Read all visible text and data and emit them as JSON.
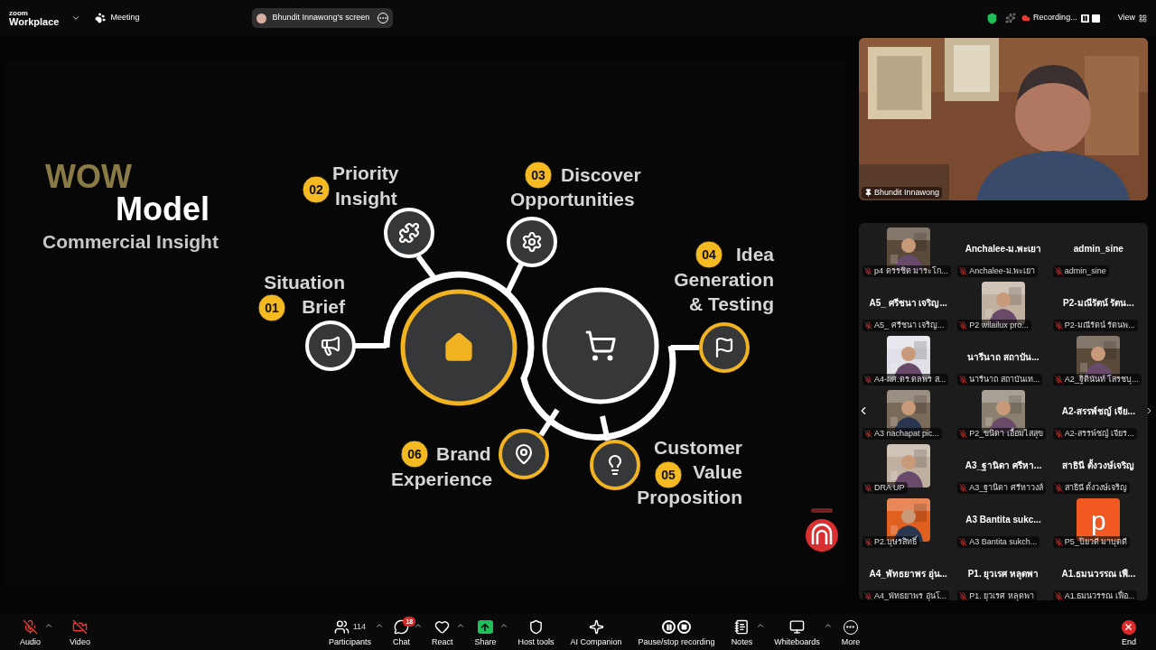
{
  "top_bar": {
    "logo_top": "zoom",
    "logo_bottom": "Workplace",
    "meeting": "Meeting",
    "share_pill": "Bhundit Innawong's screen",
    "recording": "Recording...",
    "view": "View"
  },
  "slide": {
    "title_top": "WOW",
    "title_main": "Model",
    "subtitle": "Commercial Insight",
    "steps": [
      {
        "num": "01",
        "lines": [
          "Situation",
          "Brief"
        ],
        "accent": false
      },
      {
        "num": "02",
        "lines": [
          "Priority",
          "Insight"
        ],
        "accent": false
      },
      {
        "num": "03",
        "lines": [
          "Discover",
          "Opportunities"
        ],
        "accent": false
      },
      {
        "num": "04",
        "lines": [
          "Idea",
          "Generation",
          "& Testing"
        ],
        "accent": true
      },
      {
        "num": "06",
        "lines": [
          "Brand",
          "Experience"
        ],
        "accent": true
      },
      {
        "num": "05",
        "lines": [
          "Customer",
          "Value",
          "Proposition"
        ],
        "accent": true
      }
    ]
  },
  "speaker": {
    "name": "Bhundit Innawong"
  },
  "gallery": [
    {
      "kind": "video",
      "label": "p4 ดรรชิต มาระโก..."
    },
    {
      "kind": "name",
      "display": "Anchalee-ม.พะเยา",
      "label": "Anchalee-ม.พะเยา"
    },
    {
      "kind": "name",
      "display": "admin_sine",
      "label": "admin_sine"
    },
    {
      "kind": "name",
      "display": "A5_ ศรีชนา เจริญ...",
      "label": "A5_ ศรีชนา เจริญ..."
    },
    {
      "kind": "video",
      "label": "P2 wilailux pro..."
    },
    {
      "kind": "name",
      "display": "P2-มณีรัตน์ รัตน...",
      "label": "P2-มณีรัตน์ รัตนพ..."
    },
    {
      "kind": "video",
      "label": "A4-ผศ.ดร.ดลพร ส..."
    },
    {
      "kind": "name",
      "display": "นารีนาถ สถาบัน...",
      "label": "นารีนาถ สถาบันเท..."
    },
    {
      "kind": "video",
      "label": "A2_ฐิตินันท์ โสรชบุ..."
    },
    {
      "kind": "video",
      "label": "A3 nachapat pic..."
    },
    {
      "kind": "video",
      "label": "P2_ขนิดา เอื้อมไสสุข"
    },
    {
      "kind": "name",
      "display": "A2-สรรพ์ชญ์ เจีย...",
      "label": "A2-สรรพ์ชญ์ เจียร..."
    },
    {
      "kind": "video",
      "label": "DRA UP"
    },
    {
      "kind": "name",
      "display": "A3_ฐานิดา ศรีหา...",
      "label": "A3_ฐานิดา ศรีหาวงส์"
    },
    {
      "kind": "name",
      "display": "สาธินี ตั้งวงษ์เจริญ",
      "label": "สาธินี ตั้งวงษ์เจริญ"
    },
    {
      "kind": "video",
      "label": "P2.บุษรสิทธิ์"
    },
    {
      "kind": "name",
      "display": "A3 Bantita sukc...",
      "label": "A3 Bantita sukch..."
    },
    {
      "kind": "letter",
      "display": "p",
      "label": "P5_ปิยวดี มาบุตดี"
    },
    {
      "kind": "name",
      "display": "A4_พัทธยาพร อุ่น...",
      "label": "A4_พัทธยาพร อุ่นโ..."
    },
    {
      "kind": "name",
      "display": "P1. ยุวเรศ หลุดพา",
      "label": "P1. ยุวเรศ หลุดพา"
    },
    {
      "kind": "name",
      "display": "A1.ธมนวรรณ เฟื...",
      "label": "A1.ธมนวรรณ เฟื่อ..."
    }
  ],
  "toolbar": [
    {
      "kind": "audio",
      "label": "Audio",
      "off": true,
      "caret": true
    },
    {
      "kind": "video",
      "label": "Video",
      "off": true,
      "caret": false
    },
    {
      "kind": "participants",
      "label": "Participants",
      "count": "114",
      "caret": true
    },
    {
      "kind": "chat",
      "label": "Chat",
      "badge": "18",
      "caret": true
    },
    {
      "kind": "react",
      "label": "React",
      "caret": true
    },
    {
      "kind": "share",
      "label": "Share",
      "caret": true
    },
    {
      "kind": "host",
      "label": "Host tools",
      "caret": false
    },
    {
      "kind": "ai",
      "label": "AI Companion",
      "caret": false
    },
    {
      "kind": "record",
      "label": "Pause/stop recording",
      "caret": false
    },
    {
      "kind": "notes",
      "label": "Notes",
      "caret": true
    },
    {
      "kind": "whiteboard",
      "label": "Whiteboards",
      "caret": true
    },
    {
      "kind": "more",
      "label": "More",
      "caret": false
    },
    {
      "kind": "end",
      "label": "End",
      "caret": false
    }
  ]
}
